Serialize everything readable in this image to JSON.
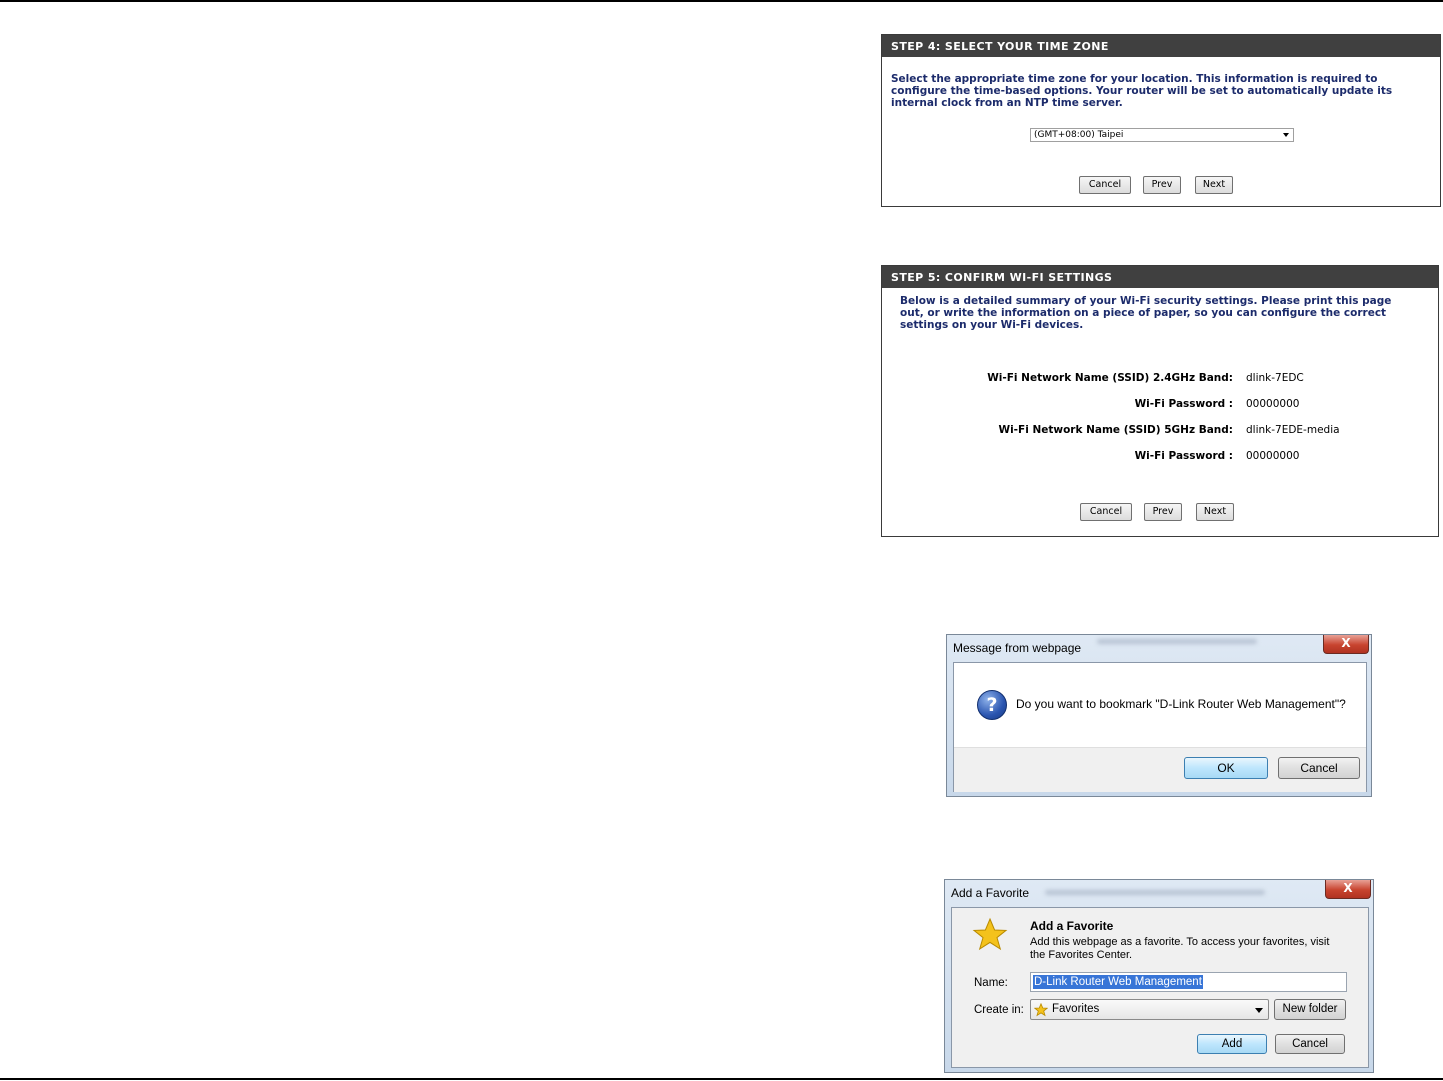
{
  "step4": {
    "title": "STEP 4: SELECT YOUR TIME ZONE",
    "description": "Select the appropriate time zone for your location. This information is required to configure the time-based options. Your router will be set to automatically update its internal clock from an NTP time server.",
    "timezone_value": "(GMT+08:00) Taipei",
    "buttons": {
      "cancel": "Cancel",
      "prev": "Prev",
      "next": "Next"
    }
  },
  "step5": {
    "title": "STEP 5: CONFIRM WI-FI SETTINGS",
    "description": "Below is a detailed summary of your Wi-Fi security settings. Please print this page out, or write the information on a piece of paper, so you can configure the correct settings on your Wi-Fi devices.",
    "rows": [
      {
        "label": "Wi-Fi Network Name (SSID)  2.4GHz Band:",
        "value": "dlink-7EDC"
      },
      {
        "label": "Wi-Fi Password :",
        "value": "00000000"
      },
      {
        "label": "Wi-Fi Network Name (SSID)  5GHz Band:",
        "value": "dlink-7EDE-media"
      },
      {
        "label": "Wi-Fi Password :",
        "value": "00000000"
      }
    ],
    "buttons": {
      "cancel": "Cancel",
      "prev": "Prev",
      "next": "Next"
    }
  },
  "message_dialog": {
    "title": "Message from webpage",
    "close": "X",
    "icon": "question-icon",
    "message": "Do you want to bookmark \"D-Link Router Web Management\"?",
    "ok": "OK",
    "cancel": "Cancel"
  },
  "favorite_dialog": {
    "title": "Add a Favorite",
    "close": "X",
    "icon": "star-icon",
    "heading": "Add a Favorite",
    "description": "Add this webpage as a favorite. To access your favorites, visit the Favorites Center.",
    "name_label": "Name:",
    "name_value": "D-Link Router Web Management",
    "create_in_label": "Create in:",
    "create_in_value": "Favorites",
    "new_folder": "New folder",
    "add": "Add",
    "cancel": "Cancel"
  }
}
